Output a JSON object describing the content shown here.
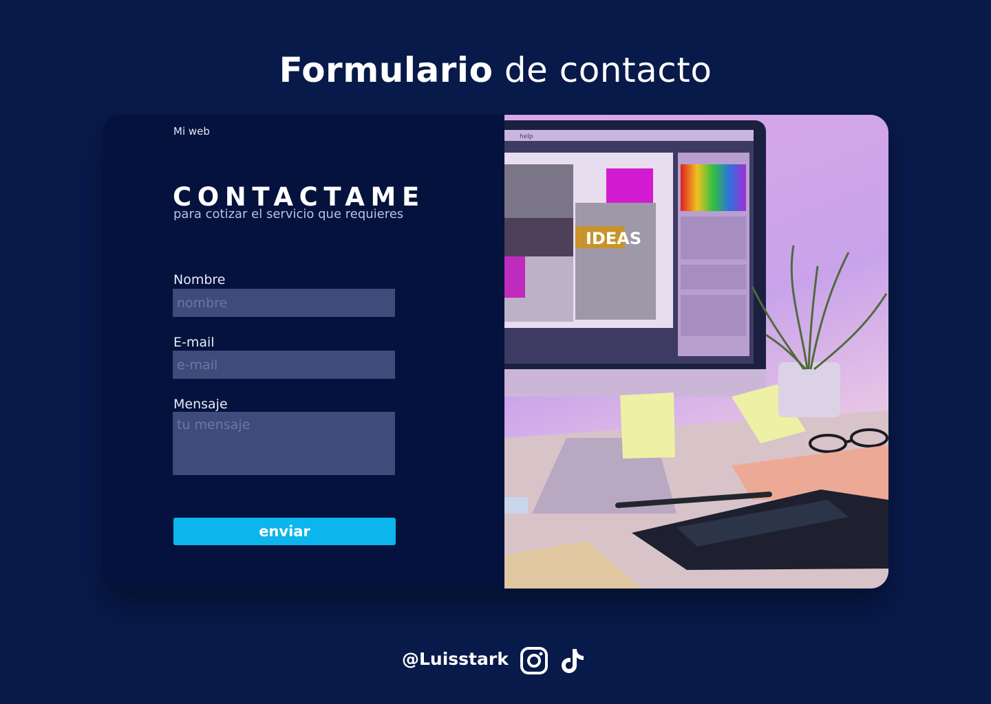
{
  "page": {
    "title_bold": "Formulario",
    "title_light": " de contacto"
  },
  "form": {
    "brand": "Mi web",
    "heading": "CONTACTAME",
    "subheading": "para cotizar el servicio que requieres",
    "fields": {
      "name": {
        "label": "Nombre",
        "placeholder": "nombre",
        "value": ""
      },
      "email": {
        "label": "E-mail",
        "placeholder": "e-mail",
        "value": ""
      },
      "message": {
        "label": "Mensaje",
        "placeholder": "tu mensaje",
        "value": ""
      }
    },
    "submit_label": "enviar"
  },
  "photo": {
    "screen_text": "IDEAS",
    "menu_text": "help"
  },
  "footer": {
    "handle": "@Luisstark",
    "icons": [
      "instagram-icon",
      "tiktok-icon"
    ]
  },
  "colors": {
    "background": "#081a4a",
    "card": "#04123d",
    "input": "#3f4b7a",
    "button": "#0cb5ec"
  }
}
